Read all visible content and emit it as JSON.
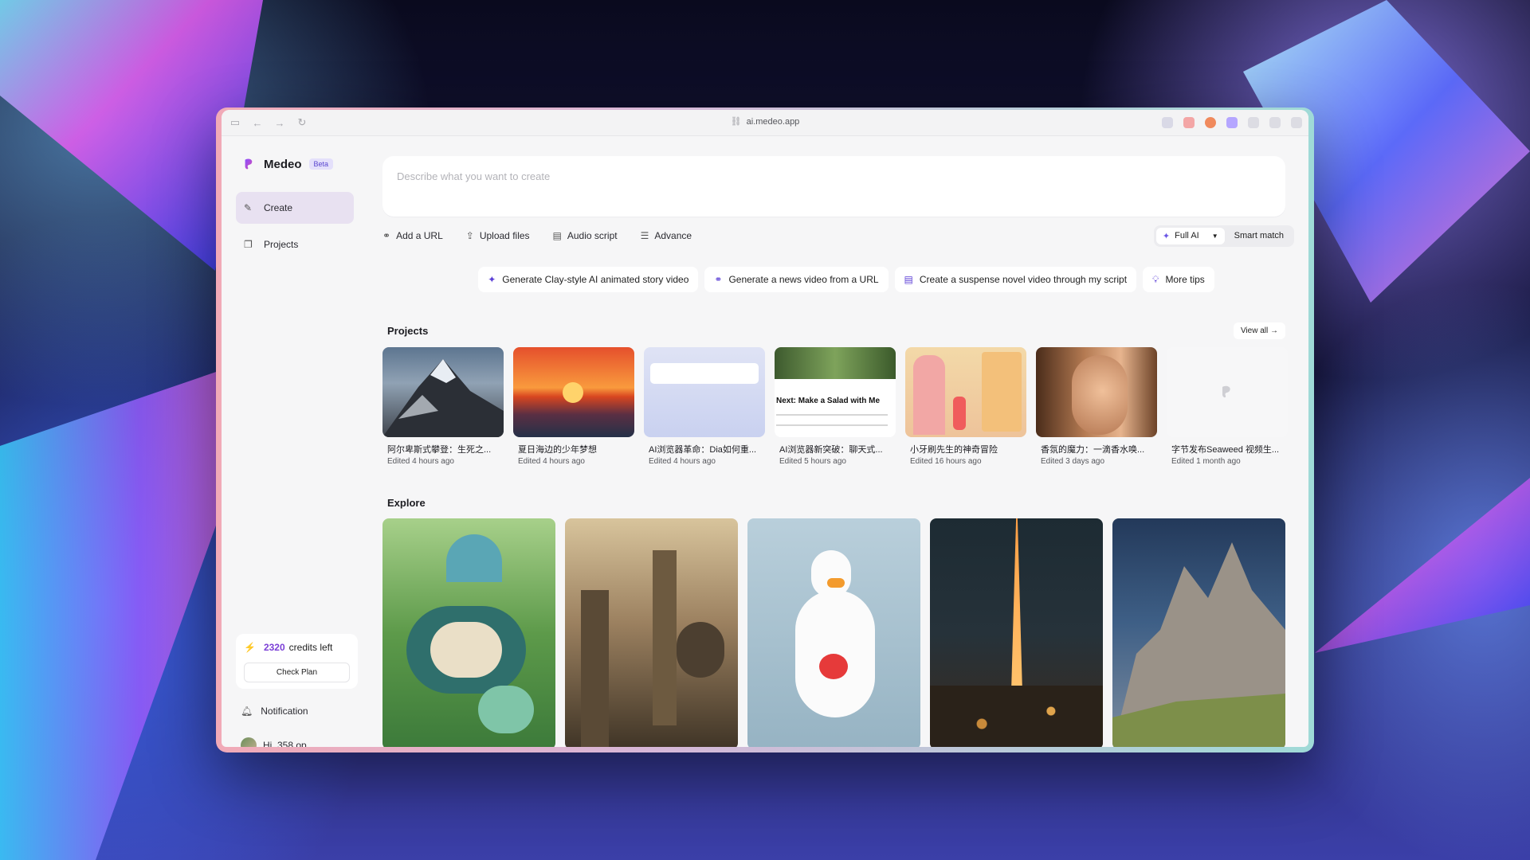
{
  "browser": {
    "url": "ai.medeo.app"
  },
  "app": {
    "name": "Medeo",
    "badge": "Beta"
  },
  "sidebar": {
    "items": [
      {
        "label": "Create",
        "icon": "wand-icon",
        "active": true
      },
      {
        "label": "Projects",
        "icon": "folders-icon",
        "active": false
      }
    ],
    "credits": {
      "count": "2320",
      "label": "credits left",
      "button": "Check Plan"
    },
    "notification": "Notification",
    "user": "Hi, 358 op"
  },
  "prompt": {
    "placeholder": "Describe what you want to create"
  },
  "toolbar": {
    "add_url": "Add a URL",
    "upload": "Upload files",
    "audio": "Audio script",
    "advance": "Advance",
    "mode": "Full AI",
    "match": "Smart match"
  },
  "tips": [
    {
      "label": "Generate Clay-style AI animated story video",
      "icon": "sparkle-icon"
    },
    {
      "label": "Generate a news video from a URL",
      "icon": "link-icon"
    },
    {
      "label": "Create a suspense novel video through my script",
      "icon": "document-icon"
    },
    {
      "label": "More tips",
      "icon": "bulb-icon"
    }
  ],
  "projects": {
    "title": "Projects",
    "view_all": "View all",
    "items": [
      {
        "title": "阿尔卑斯式攀登：生死之...",
        "time": "Edited 4 hours ago"
      },
      {
        "title": "夏日海边的少年梦想",
        "time": "Edited 4 hours ago"
      },
      {
        "title": "AI浏览器革命：Dia如何重...",
        "time": "Edited 4 hours ago"
      },
      {
        "title": "AI浏览器新突破：聊天式...",
        "time": "Edited 5 hours ago",
        "thumb_text": "Next: Make a Salad with Me"
      },
      {
        "title": "小牙刷先生的神奇冒险",
        "time": "Edited 16 hours ago"
      },
      {
        "title": "香氛的魔力：一滴香水唤...",
        "time": "Edited 3 days ago"
      },
      {
        "title": "字节发布Seaweed 视频生...",
        "time": "Edited 1 month ago"
      }
    ]
  },
  "explore": {
    "title": "Explore"
  },
  "colors": {
    "accent": "#7b3fd6",
    "active_nav": "#e8e1f1",
    "beta_bg": "#e4e0fb"
  }
}
